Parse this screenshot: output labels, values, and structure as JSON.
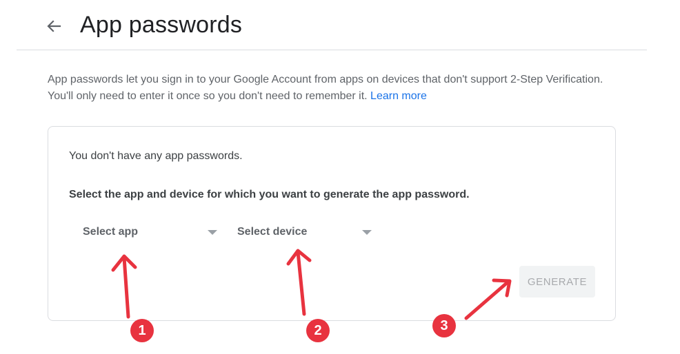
{
  "header": {
    "title": "App passwords",
    "back_icon": "arrow-left-icon"
  },
  "intro": {
    "text": "App passwords let you sign in to your Google Account from apps on devices that don't support 2-Step Verification. You'll only need to enter it once so you don't need to remember it.",
    "learn_more": "Learn more"
  },
  "card": {
    "empty_message": "You don't have any app passwords.",
    "instruction": "Select the app and device for which you want to generate the app password.",
    "select_app": {
      "label": "Select app",
      "icon": "dropdown-arrow-icon"
    },
    "select_device": {
      "label": "Select device",
      "icon": "dropdown-arrow-icon"
    },
    "generate_label": "GENERATE"
  },
  "annotations": {
    "steps": [
      "1",
      "2",
      "3"
    ],
    "color": "#e8333f"
  },
  "colors": {
    "link": "#1a73e8",
    "text_secondary": "#5f6368",
    "border": "#dadce0",
    "button_disabled_bg": "#f1f3f4",
    "annotation": "#e8333f"
  }
}
